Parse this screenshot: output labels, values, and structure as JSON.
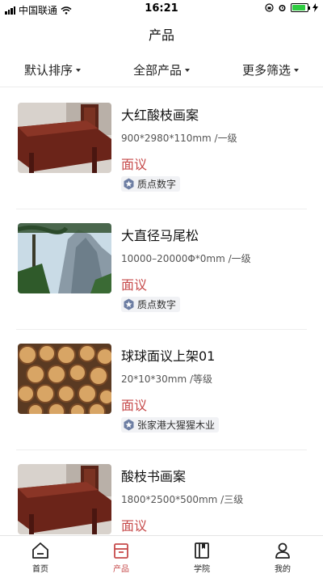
{
  "status": {
    "carrier": "中国联通",
    "time": "16:21"
  },
  "nav": {
    "title": "产品"
  },
  "filters": [
    {
      "label": "默认排序"
    },
    {
      "label": "全部产品"
    },
    {
      "label": "更多筛选"
    }
  ],
  "products": [
    {
      "title": "大红酸枝画案",
      "spec": "900*2980*110mm /一级",
      "price": "面议",
      "seller": "质点数字"
    },
    {
      "title": "大直径马尾松",
      "spec": "10000–20000Φ*0mm /一级",
      "price": "面议",
      "seller": "质点数字"
    },
    {
      "title": "球球面议上架01",
      "spec": "20*10*30mm /等级",
      "price": "面议",
      "seller": "张家港大猩猩木业"
    },
    {
      "title": "酸枝书画案",
      "spec": "1800*2500*500mm /三级",
      "price": "面议",
      "seller": ""
    }
  ],
  "tabs": [
    {
      "label": "首页",
      "icon": "home-icon"
    },
    {
      "label": "产品",
      "icon": "box-icon",
      "active": true
    },
    {
      "label": "学院",
      "icon": "book-icon"
    },
    {
      "label": "我的",
      "icon": "user-icon"
    }
  ],
  "colors": {
    "accent": "#c64a4a",
    "battery": "#2ecc40"
  }
}
